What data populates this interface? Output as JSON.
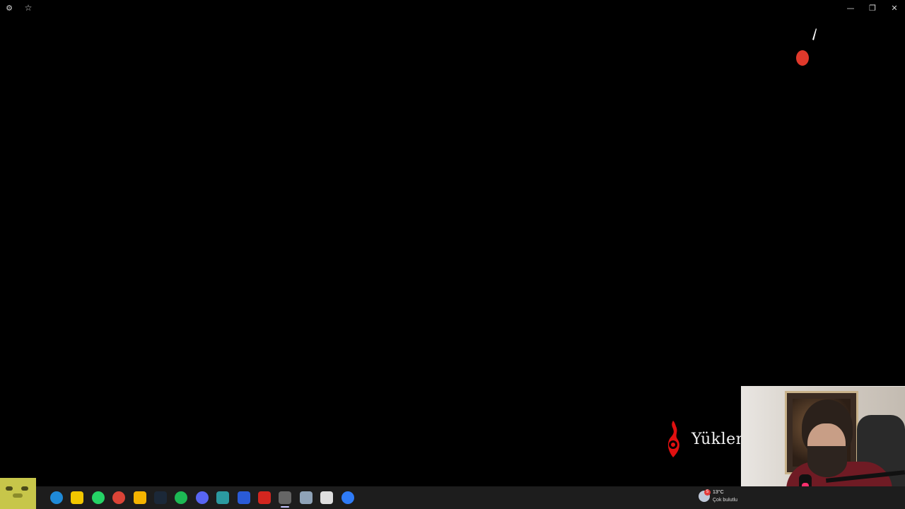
{
  "window": {
    "settings_icon": "gear-icon",
    "favorite_icon": "star-outline-icon",
    "minimize_icon": "minimize-icon",
    "restore_icon": "restore-icon",
    "close_icon": "close-icon"
  },
  "game": {
    "loading_text": "Yüklen",
    "accent_red": "#e0392b"
  },
  "taskbar": {
    "apps": [
      {
        "name": "edge",
        "icon": "edge-icon",
        "color": "#1f8ad8"
      },
      {
        "name": "sticky-notes",
        "icon": "sticky-notes-icon",
        "color": "#f2c700"
      },
      {
        "name": "whatsapp",
        "icon": "whatsapp-icon",
        "color": "#25d366"
      },
      {
        "name": "chrome",
        "icon": "chrome-icon",
        "color": "#db4437"
      },
      {
        "name": "file-explorer",
        "icon": "folder-icon",
        "color": "#f4b400"
      },
      {
        "name": "steam",
        "icon": "steam-icon",
        "color": "#1b2838"
      },
      {
        "name": "spotify",
        "icon": "spotify-icon",
        "color": "#1db954"
      },
      {
        "name": "discord",
        "icon": "discord-icon",
        "color": "#5865f2"
      },
      {
        "name": "app-teal",
        "icon": "app-icon",
        "color": "#2b9aa0"
      },
      {
        "name": "app-blue",
        "icon": "app-icon",
        "color": "#2a5bd7"
      },
      {
        "name": "acrobat",
        "icon": "acrobat-icon",
        "color": "#d3261f"
      },
      {
        "name": "game-active",
        "icon": "game-icon",
        "color": "#666666"
      },
      {
        "name": "settings",
        "icon": "gear-icon",
        "color": "#8fa3b8"
      },
      {
        "name": "store",
        "icon": "store-icon",
        "color": "#dedede"
      },
      {
        "name": "app-fblue",
        "icon": "app-icon",
        "color": "#2f7bf6"
      }
    ]
  },
  "weather": {
    "badge": "5",
    "temp": "13°C",
    "condition": "Çok bulutlu"
  }
}
